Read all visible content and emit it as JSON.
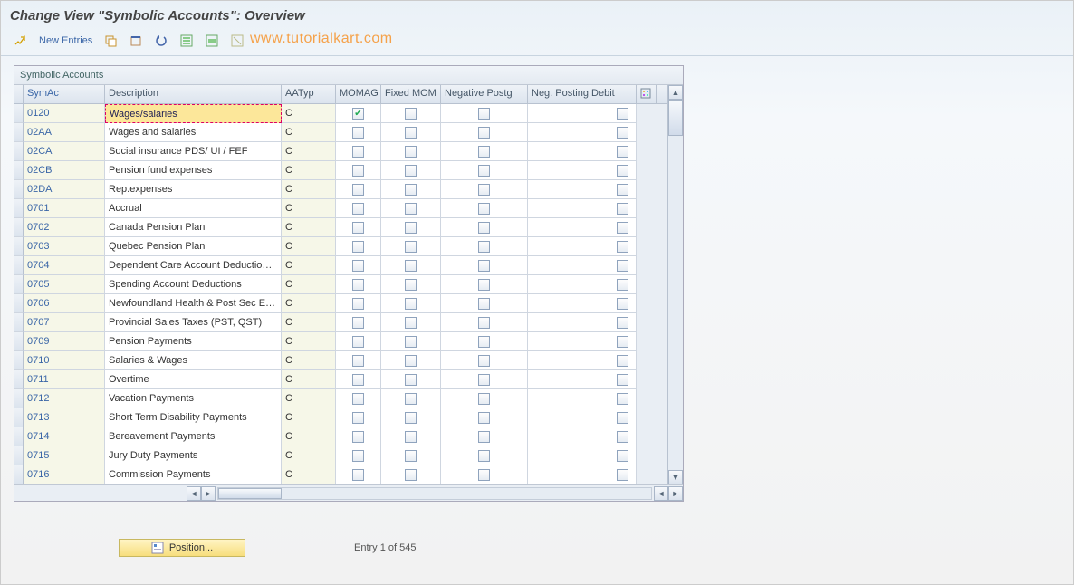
{
  "title": "Change View \"Symbolic Accounts\": Overview",
  "toolbar": {
    "new_entries": "New Entries"
  },
  "watermark": "www.tutorialkart.com",
  "panel_title": "Symbolic Accounts",
  "columns": {
    "symac": "SymAc",
    "desc": "Description",
    "aatyp": "AATyp",
    "momag": "MOMAG",
    "fixed": "Fixed MOM",
    "neg": "Negative Postg",
    "negd": "Neg. Posting Debit"
  },
  "rows": [
    {
      "symac": "0120",
      "desc": "Wages/salaries",
      "aatyp": "C",
      "momag": true,
      "fixed": false,
      "neg": false,
      "negd": false
    },
    {
      "symac": "02AA",
      "desc": "Wages and salaries",
      "aatyp": "C",
      "momag": false,
      "fixed": false,
      "neg": false,
      "negd": false
    },
    {
      "symac": "02CA",
      "desc": "Social insurance PDS/ UI / FEF",
      "aatyp": "C",
      "momag": false,
      "fixed": false,
      "neg": false,
      "negd": false
    },
    {
      "symac": "02CB",
      "desc": "Pension fund expenses",
      "aatyp": "C",
      "momag": false,
      "fixed": false,
      "neg": false,
      "negd": false
    },
    {
      "symac": "02DA",
      "desc": "Rep.expenses",
      "aatyp": "C",
      "momag": false,
      "fixed": false,
      "neg": false,
      "negd": false
    },
    {
      "symac": "0701",
      "desc": "Accrual",
      "aatyp": "C",
      "momag": false,
      "fixed": false,
      "neg": false,
      "negd": false
    },
    {
      "symac": "0702",
      "desc": "Canada Pension Plan",
      "aatyp": "C",
      "momag": false,
      "fixed": false,
      "neg": false,
      "negd": false
    },
    {
      "symac": "0703",
      "desc": "Quebec Pension Plan",
      "aatyp": "C",
      "momag": false,
      "fixed": false,
      "neg": false,
      "negd": false
    },
    {
      "symac": "0704",
      "desc": "Dependent Care Account Deductio…",
      "aatyp": "C",
      "momag": false,
      "fixed": false,
      "neg": false,
      "negd": false
    },
    {
      "symac": "0705",
      "desc": "Spending Account Deductions",
      "aatyp": "C",
      "momag": false,
      "fixed": false,
      "neg": false,
      "negd": false
    },
    {
      "symac": "0706",
      "desc": "Newfoundland Health & Post Sec E…",
      "aatyp": "C",
      "momag": false,
      "fixed": false,
      "neg": false,
      "negd": false
    },
    {
      "symac": "0707",
      "desc": "Provincial Sales Taxes (PST, QST)",
      "aatyp": "C",
      "momag": false,
      "fixed": false,
      "neg": false,
      "negd": false
    },
    {
      "symac": "0709",
      "desc": "Pension Payments",
      "aatyp": "C",
      "momag": false,
      "fixed": false,
      "neg": false,
      "negd": false
    },
    {
      "symac": "0710",
      "desc": "Salaries & Wages",
      "aatyp": "C",
      "momag": false,
      "fixed": false,
      "neg": false,
      "negd": false
    },
    {
      "symac": "0711",
      "desc": "Overtime",
      "aatyp": "C",
      "momag": false,
      "fixed": false,
      "neg": false,
      "negd": false
    },
    {
      "symac": "0712",
      "desc": "Vacation Payments",
      "aatyp": "C",
      "momag": false,
      "fixed": false,
      "neg": false,
      "negd": false
    },
    {
      "symac": "0713",
      "desc": "Short Term Disability Payments",
      "aatyp": "C",
      "momag": false,
      "fixed": false,
      "neg": false,
      "negd": false
    },
    {
      "symac": "0714",
      "desc": "Bereavement Payments",
      "aatyp": "C",
      "momag": false,
      "fixed": false,
      "neg": false,
      "negd": false
    },
    {
      "symac": "0715",
      "desc": "Jury Duty Payments",
      "aatyp": "C",
      "momag": false,
      "fixed": false,
      "neg": false,
      "negd": false
    },
    {
      "symac": "0716",
      "desc": "Commission Payments",
      "aatyp": "C",
      "momag": false,
      "fixed": false,
      "neg": false,
      "negd": false
    }
  ],
  "footer": {
    "position_label": "Position...",
    "entry_label": "Entry 1 of 545"
  }
}
